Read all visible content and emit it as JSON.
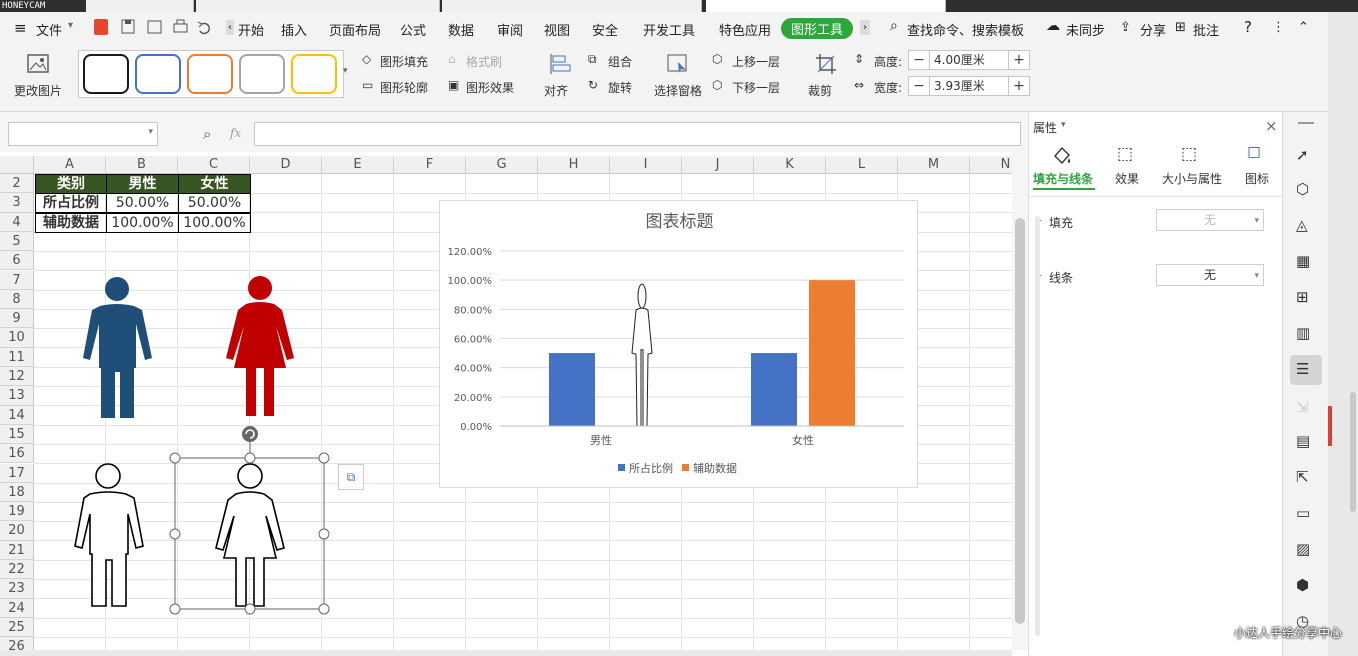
{
  "window": {
    "recorder_mark": "HONEYCAM"
  },
  "menu": {
    "file": "文件",
    "tabs": [
      "开始",
      "插入",
      "页面布局",
      "公式",
      "数据",
      "审阅",
      "视图",
      "安全",
      "开发工具",
      "特色应用",
      "图形工具"
    ],
    "search": "查找命令、搜索模板",
    "sync": "未同步",
    "share": "分享",
    "comment": "批注"
  },
  "ribbon": {
    "change_picture": "更改图片",
    "shape_fill": "图形填充",
    "format_brush": "格式刷",
    "shape_outline": "图形轮廓",
    "shape_effect": "图形效果",
    "align": "对齐",
    "group": "组合",
    "rotate": "旋转",
    "selection_pane": "选择窗格",
    "bring_forward": "上移一层",
    "send_backward": "下移一层",
    "crop": "裁剪",
    "height_label": "高度:",
    "height_value": "4.00厘米",
    "width_label": "宽度:",
    "width_value": "3.93厘米",
    "style_colors": [
      "#1a1a1a",
      "#4472c4",
      "#ed7d31",
      "#a5a5a5",
      "#ffc000"
    ]
  },
  "formula": {
    "fx": "fx"
  },
  "sheet": {
    "columns": [
      "A",
      "B",
      "C",
      "D",
      "E",
      "F",
      "G",
      "H",
      "I",
      "J",
      "K",
      "L",
      "M",
      "N"
    ],
    "rows": [
      "2",
      "3",
      "4",
      "5",
      "6",
      "7",
      "8",
      "9",
      "10",
      "11",
      "12",
      "13",
      "14",
      "15",
      "16",
      "17",
      "18",
      "19",
      "20",
      "21",
      "22",
      "23",
      "24",
      "25",
      "26"
    ],
    "table": {
      "header": [
        "类别",
        "男性",
        "女性"
      ],
      "row1": [
        "所占比例",
        "50.00%",
        "50.00%"
      ],
      "row2": [
        "辅助数据",
        "100.00%",
        "100.00%"
      ]
    },
    "header_color": "#375623",
    "male_color": "#1f4e79",
    "female_color": "#c00000"
  },
  "chart_data": {
    "type": "bar",
    "title": "图表标题",
    "categories": [
      "男性",
      "女性"
    ],
    "series": [
      {
        "name": "所占比例",
        "values": [
          0.5,
          0.5
        ],
        "color": "#4472c4"
      },
      {
        "name": "辅助数据",
        "values": [
          null,
          1.0
        ],
        "color": "#ed7d31"
      }
    ],
    "ylim": [
      0,
      1.2
    ],
    "yticks": [
      "0.00%",
      "20.00%",
      "40.00%",
      "60.00%",
      "80.00%",
      "100.00%",
      "120.00%"
    ],
    "grid": true,
    "legend": "bottom"
  },
  "panel": {
    "title": "属性",
    "tabs": [
      "填充与线条",
      "效果",
      "大小与属性",
      "图标"
    ],
    "fill_label": "填充",
    "fill_value": "无",
    "line_label": "线条",
    "line_value": "无"
  },
  "watermark": "小达人手绘分享中心"
}
